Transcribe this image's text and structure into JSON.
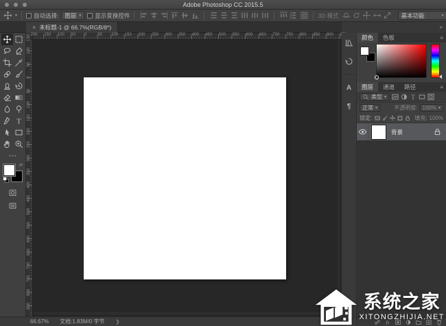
{
  "window": {
    "title": "Adobe Photoshop CC 2015.5"
  },
  "options_bar": {
    "auto_select_label": "自动选择:",
    "auto_select_value": "图层",
    "show_transform_label": "显示变换控件",
    "mode_3d_label": "3D 模式",
    "workspace_value": "基本功能",
    "align_icons": [
      "align-left-edges",
      "align-horizontal-centers",
      "align-right-edges",
      "align-top-edges",
      "align-vertical-centers",
      "align-bottom-edges"
    ],
    "distribute_icons": [
      "distribute-top-edges",
      "distribute-vertical-centers",
      "distribute-bottom-edges",
      "distribute-left-edges",
      "distribute-horizontal-centers",
      "distribute-right-edges"
    ],
    "spacing_icons": [
      "distribute-horizontal-spacing",
      "distribute-vertical-spacing",
      "auto-align-layers"
    ],
    "mode_3d_icons": [
      "3d-orbit",
      "3d-roll",
      "3d-pan",
      "3d-slide",
      "3d-scale"
    ]
  },
  "document_tab": {
    "title": "未标题-1 @ 66.7%(RGB/8*)"
  },
  "tools": [
    {
      "name": "move-tool",
      "selected": true
    },
    {
      "name": "rectangular-marquee-tool",
      "selected": false
    },
    {
      "name": "lasso-tool",
      "selected": false
    },
    {
      "name": "quick-selection-tool",
      "selected": false
    },
    {
      "name": "crop-tool",
      "selected": false
    },
    {
      "name": "eyedropper-tool",
      "selected": false
    },
    {
      "name": "spot-healing-brush-tool",
      "selected": false
    },
    {
      "name": "brush-tool",
      "selected": false
    },
    {
      "name": "clone-stamp-tool",
      "selected": false
    },
    {
      "name": "history-brush-tool",
      "selected": false
    },
    {
      "name": "eraser-tool",
      "selected": false
    },
    {
      "name": "gradient-tool",
      "selected": false
    },
    {
      "name": "blur-tool",
      "selected": false
    },
    {
      "name": "dodge-tool",
      "selected": false
    },
    {
      "name": "pen-tool",
      "selected": false
    },
    {
      "name": "type-tool",
      "selected": false
    },
    {
      "name": "path-selection-tool",
      "selected": false
    },
    {
      "name": "rectangle-tool",
      "selected": false
    },
    {
      "name": "hand-tool",
      "selected": false
    },
    {
      "name": "zoom-tool",
      "selected": false
    }
  ],
  "tool_footer": {
    "foreground_color": "#ffffff",
    "background_color": "#000000"
  },
  "rulers": {
    "horizontal": [
      "200",
      "150",
      "100",
      "50",
      "0",
      "50",
      "100",
      "150",
      "200",
      "250",
      "300",
      "350",
      "400",
      "450",
      "500",
      "550",
      "600",
      "650",
      "700",
      "750",
      "800",
      "850",
      "900",
      "950"
    ],
    "vertical": [
      "150",
      "100",
      "50",
      "0",
      "50",
      "100",
      "150",
      "200",
      "250",
      "300",
      "350",
      "400",
      "450",
      "500",
      "550",
      "600",
      "650",
      "700",
      "750",
      "800",
      "850"
    ]
  },
  "dock_strip": [
    "libraries-panel",
    "history-panel",
    "character-panel",
    "paragraph-panel"
  ],
  "color_panel": {
    "tabs": [
      {
        "label": "颜色",
        "active": true
      },
      {
        "label": "色板",
        "active": false
      }
    ]
  },
  "layers_panel": {
    "tabs": [
      {
        "label": "图层",
        "active": true
      },
      {
        "label": "通道",
        "active": false
      },
      {
        "label": "路径",
        "active": false
      }
    ],
    "filter_label": "类型",
    "filter_icons": [
      "filter-pixel-layers",
      "filter-adjustment-layers",
      "filter-type-layers",
      "filter-shape-layers",
      "filter-smart-objects"
    ],
    "blend_mode": "正常",
    "opacity_label": "不透明度:",
    "opacity_value": "100%",
    "lock_label": "锁定:",
    "lock_icons": [
      "lock-transparent-pixels",
      "lock-image-pixels",
      "lock-position",
      "lock-artboards",
      "lock-all"
    ],
    "fill_label": "填充:",
    "fill_value": "100%",
    "layers": [
      {
        "name": "背景",
        "visible": true,
        "locked": true,
        "selected": true
      }
    ],
    "bottom_icons": [
      "link-layers",
      "layer-style",
      "layer-mask",
      "new-adjustment-layer",
      "new-group",
      "new-layer",
      "delete-layer"
    ]
  },
  "status_bar": {
    "zoom": "66.67%",
    "doc_info": "文档:1.83M/0 字节"
  },
  "watermark": {
    "title": "系统之家",
    "subtitle": "XITONGZHIJIA.NET"
  },
  "colors": {
    "pasteboard": "#272727",
    "panel_bg": "#3f3f3f",
    "selected_layer": "#56585b",
    "canvas": "#ffffff"
  }
}
